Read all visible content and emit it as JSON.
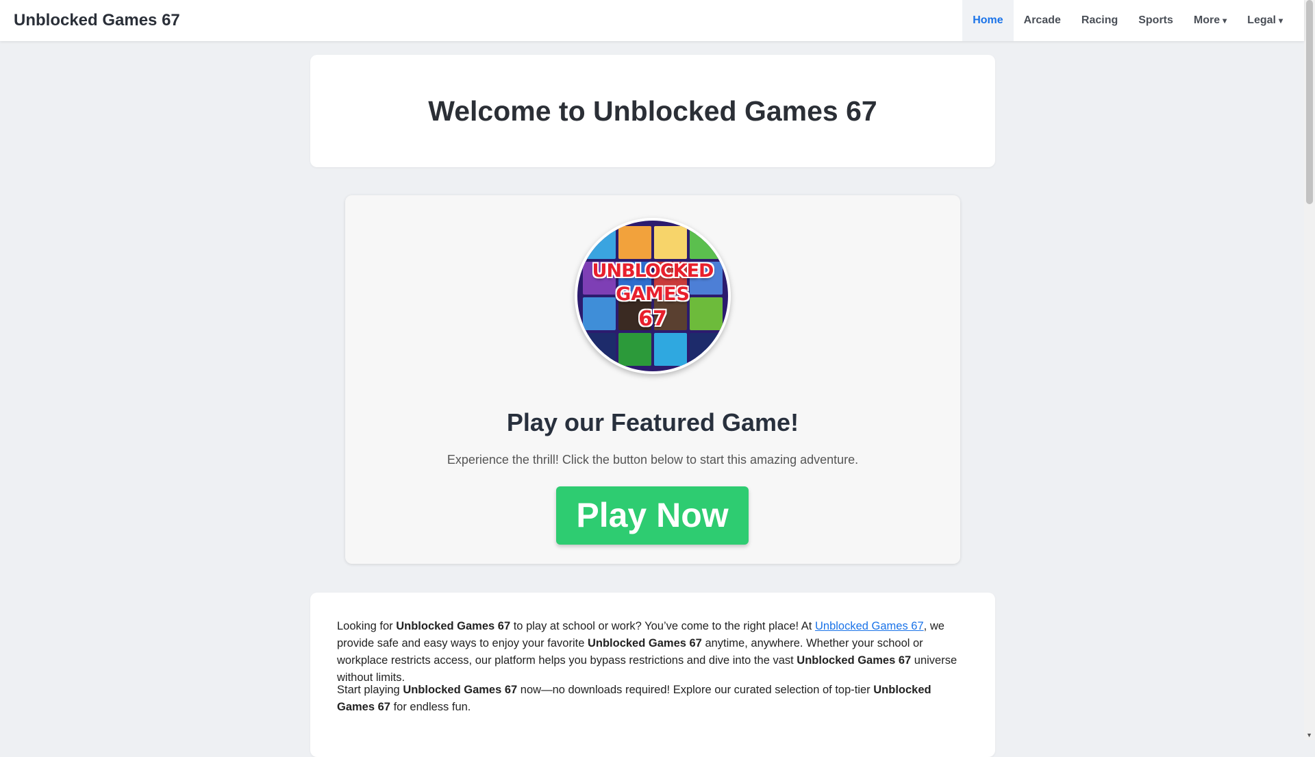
{
  "navbar": {
    "brand": "Unblocked Games 67",
    "items": [
      {
        "label": "Home",
        "active": true
      },
      {
        "label": "Arcade"
      },
      {
        "label": "Racing"
      },
      {
        "label": "Sports"
      },
      {
        "label": "More",
        "caret": "▾"
      },
      {
        "label": "Legal",
        "caret": "▾"
      }
    ]
  },
  "welcome": {
    "title": "Welcome to Unblocked Games 67"
  },
  "featured": {
    "logo_text": [
      "UNBLOCKED",
      "GAMES",
      "67"
    ],
    "title": "Play our Featured Game!",
    "description": "Experience the thrill! Click the button below to start this amazing adventure.",
    "button": "Play Now",
    "button_color": "#2ecc71"
  },
  "intro": {
    "p1": {
      "t1": "Looking for ",
      "b1": "Unblocked Games 67",
      "t2": " to play at school or work? You’ve come to the right place! At ",
      "link": "Unblocked Games 67",
      "t3": ", we provide safe and easy ways to enjoy your favorite ",
      "b2": "Unblocked Games 67",
      "t4": " anytime, anywhere. Whether your school or workplace restricts access, our platform helps you bypass restrictions and dive into the vast ",
      "b3": "Unblocked Games 67",
      "t5": " universe without limits."
    },
    "p2": {
      "t1": "Start playing ",
      "b1": "Unblocked Games 67",
      "t2": " now—no downloads required! Explore our curated selection of top-tier ",
      "b2": "Unblocked Games 67",
      "t3": " for endless fun."
    }
  },
  "colors": {
    "accent": "#1a73e8",
    "play_green": "#2ecc71",
    "logo_red": "#e8202d"
  }
}
